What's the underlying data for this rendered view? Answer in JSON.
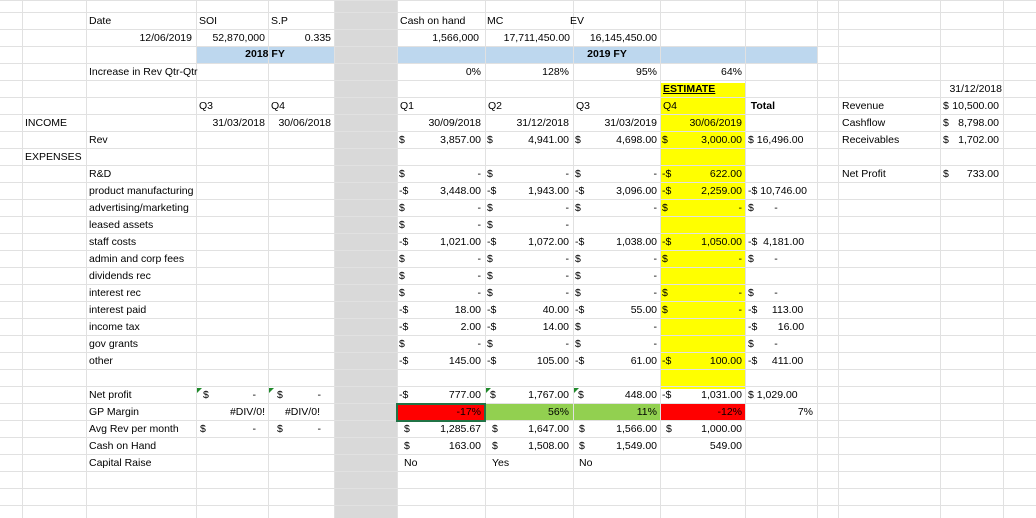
{
  "header": {
    "date_label": "Date",
    "soi_label": "SOI",
    "sp_label": "S.P",
    "date_value": "12/06/2019",
    "soi_value": "52,870,000",
    "sp_value": "0.335",
    "cash_label": "Cash on hand",
    "mc_label": "MC",
    "ev_label": "EV",
    "cash_value": "1,566,000",
    "mc_value": "17,711,450.00",
    "ev_value": "16,145,450.00",
    "fy2018": "2018 FY",
    "fy2019": "2019 FY",
    "increase_label": "Increase in Rev Qtr-Qtr",
    "inc_q1": "0%",
    "inc_q2": "128%",
    "inc_q3": "95%",
    "inc_q4": "64%",
    "estimate": "ESTIMATE"
  },
  "quarters": {
    "q3a": "Q3",
    "q4a": "Q4",
    "q1": "Q1",
    "q2": "Q2",
    "q3": "Q3",
    "q4": "Q4",
    "total": "Total",
    "d_q3a": "31/03/2018",
    "d_q4a": "30/06/2018",
    "d_q1": "30/09/2018",
    "d_q2": "31/12/2018",
    "d_q3": "31/03/2019",
    "d_q4": "30/06/2019"
  },
  "sections": {
    "income": "INCOME",
    "expenses": "EXPENSES"
  },
  "rows": {
    "rev": [
      "Rev",
      "$",
      "3,857.00",
      "$",
      "4,941.00",
      "$",
      "4,698.00",
      "$",
      "3,000.00",
      "$ 16,496.00"
    ],
    "rd": [
      "R&D",
      "$",
      "-",
      "$",
      "-",
      "$",
      "-",
      "-$",
      "622.00",
      ""
    ],
    "pm": [
      "product manufacturing",
      "-$",
      "3,448.00",
      "-$",
      "1,943.00",
      "-$",
      "3,096.00",
      "-$",
      "2,259.00",
      "-$ 10,746.00"
    ],
    "am": [
      "advertising/marketing",
      "$",
      "-",
      "$",
      "-",
      "$",
      "-",
      "$",
      "-",
      "$       -"
    ],
    "la": [
      "leased assets",
      "$",
      "-",
      "$",
      "-",
      "",
      "",
      "",
      "",
      ""
    ],
    "sc": [
      "staff costs",
      "-$",
      "1,021.00",
      "-$",
      "1,072.00",
      "-$",
      "1,038.00",
      "-$",
      "1,050.00",
      "-$  4,181.00"
    ],
    "ac": [
      "admin and corp fees",
      "$",
      "-",
      "$",
      "-",
      "$",
      "-",
      "$",
      "-",
      "$       -"
    ],
    "dr": [
      "dividends rec",
      "$",
      "-",
      "$",
      "-",
      "$",
      "-",
      "",
      "",
      ""
    ],
    "ir": [
      "interest rec",
      "$",
      "-",
      "$",
      "-",
      "$",
      "-",
      "$",
      "-",
      "$       -"
    ],
    "ip": [
      "interest paid",
      "-$",
      "18.00",
      "-$",
      "40.00",
      "-$",
      "55.00",
      "$",
      "-",
      "-$     113.00"
    ],
    "it": [
      "income tax",
      "-$",
      "2.00",
      "-$",
      "14.00",
      "$",
      "-",
      "",
      "",
      "-$       16.00"
    ],
    "gg": [
      "gov grants",
      "$",
      "-",
      "$",
      "-",
      "$",
      "-",
      "",
      "",
      "$       -"
    ],
    "ot": [
      "other",
      "-$",
      "145.00",
      "-$",
      "105.00",
      "-$",
      "61.00",
      "-$",
      "100.00",
      "-$     411.00"
    ]
  },
  "summary": {
    "np_label": "Net profit",
    "gp_label": "GP Margin",
    "avg_label": "Avg Rev per month",
    "coh_label": "Cash on Hand",
    "cr_label": "Capital Raise",
    "np_q3a_s": "$",
    "np_q3a_v": "-",
    "np_q4a_s": "$",
    "np_q4a_v": "-",
    "gp_q3a": "#DIV/0!",
    "gp_q4a": "#DIV/0!",
    "avg_q3a_s": "$",
    "avg_q3a_v": "-",
    "avg_q4a_s": "$",
    "avg_q4a_v": "-",
    "np_q1_s": "-$",
    "np_q1_v": "777.00",
    "np_q2_s": "$",
    "np_q2_v": "1,767.00",
    "np_q3_s": "$",
    "np_q3_v": "448.00",
    "np_q4_s": "-$",
    "np_q4_v": "1,031.00",
    "np_total": "$  1,029.00",
    "gp_q1": "-17%",
    "gp_q2": "56%",
    "gp_q3": "11%",
    "gp_q4": "-12%",
    "gp_total": "7%",
    "avg_q1_s": "$",
    "avg_q1_v": "1,285.67",
    "avg_q2_s": "$",
    "avg_q2_v": "1,647.00",
    "avg_q3_s": "$",
    "avg_q3_v": "1,566.00",
    "avg_q4_s": "$",
    "avg_q4_v": "1,000.00",
    "coh_q1_s": "$",
    "coh_q1_v": "163.00",
    "coh_q2_s": "$",
    "coh_q2_v": "1,508.00",
    "coh_q3_s": "$",
    "coh_q3_v": "1,549.00",
    "coh_q4_v": "549.00",
    "cr_q1": "No",
    "cr_q2": "Yes",
    "cr_q3": "No"
  },
  "side": {
    "date": "31/12/2018",
    "revenue_label": "Revenue",
    "revenue_s": "$",
    "revenue_v": "10,500.00",
    "cashflow_label": "Cashflow",
    "cashflow_s": "$",
    "cashflow_v": "8,798.00",
    "receivables_label": "Receivables",
    "receivables_s": "$",
    "receivables_v": "1,702.00",
    "netprofit_label": "Net Profit",
    "netprofit_s": "$",
    "netprofit_v": "733.00"
  },
  "colors": {
    "header_band": "#bdd7ee",
    "estimate_fill": "#ffff00",
    "negative_fill": "#ff0000",
    "positive_fill": "#92d050",
    "hidden_column": "#d9d9d9",
    "gridline": "#e1e1e1"
  }
}
